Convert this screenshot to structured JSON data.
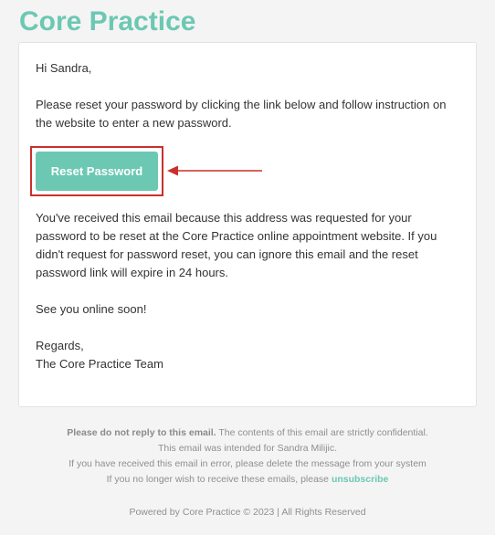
{
  "brand": {
    "name": "Core Practice",
    "color": "#6cc8b3"
  },
  "email": {
    "greeting": "Hi Sandra,",
    "intro": "Please reset your password by clicking the link below and follow instruction on the website to enter a new password.",
    "reset_button_label": "Reset Password",
    "explanation": "You've received this email because this address was requested for your password to be reset at the Core Practice online appointment website. If you didn't request for password reset, you can ignore this email and the reset password link will expire in 24 hours.",
    "signoff": "See you online soon!",
    "regards": "Regards,",
    "team": "The Core Practice Team"
  },
  "annotation": {
    "highlight_color": "#c9302c"
  },
  "footer": {
    "no_reply_bold": "Please do not reply to this email.",
    "confidential": " The contents of this email are strictly confidential.",
    "intended_for": "This email was intended for Sandra Milijic.",
    "error_notice": "If you have received this email in error, please delete the message from your system",
    "unsubscribe_prefix": "If you no longer wish to receive these emails, please ",
    "unsubscribe_link": "unsubscribe",
    "powered_by": "Powered by Core Practice © 2023 | All Rights Reserved"
  }
}
